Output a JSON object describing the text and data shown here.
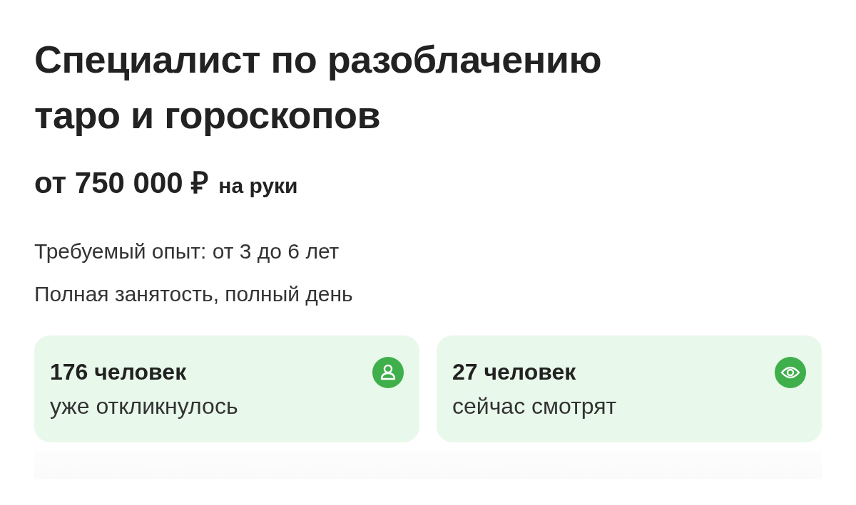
{
  "title": "Специалист по разоблачению таро и гороскопов",
  "salary": {
    "amount": "от 750 000 ₽",
    "note": "на руки"
  },
  "details": [
    "Требуемый опыт: от 3 до 6 лет",
    "Полная занятость, полный день"
  ],
  "stats": [
    {
      "kind": "responses",
      "count": "176 человек",
      "label": "уже откликнулось"
    },
    {
      "kind": "viewers",
      "count": "27 человек",
      "label": "сейчас смотрят"
    }
  ]
}
